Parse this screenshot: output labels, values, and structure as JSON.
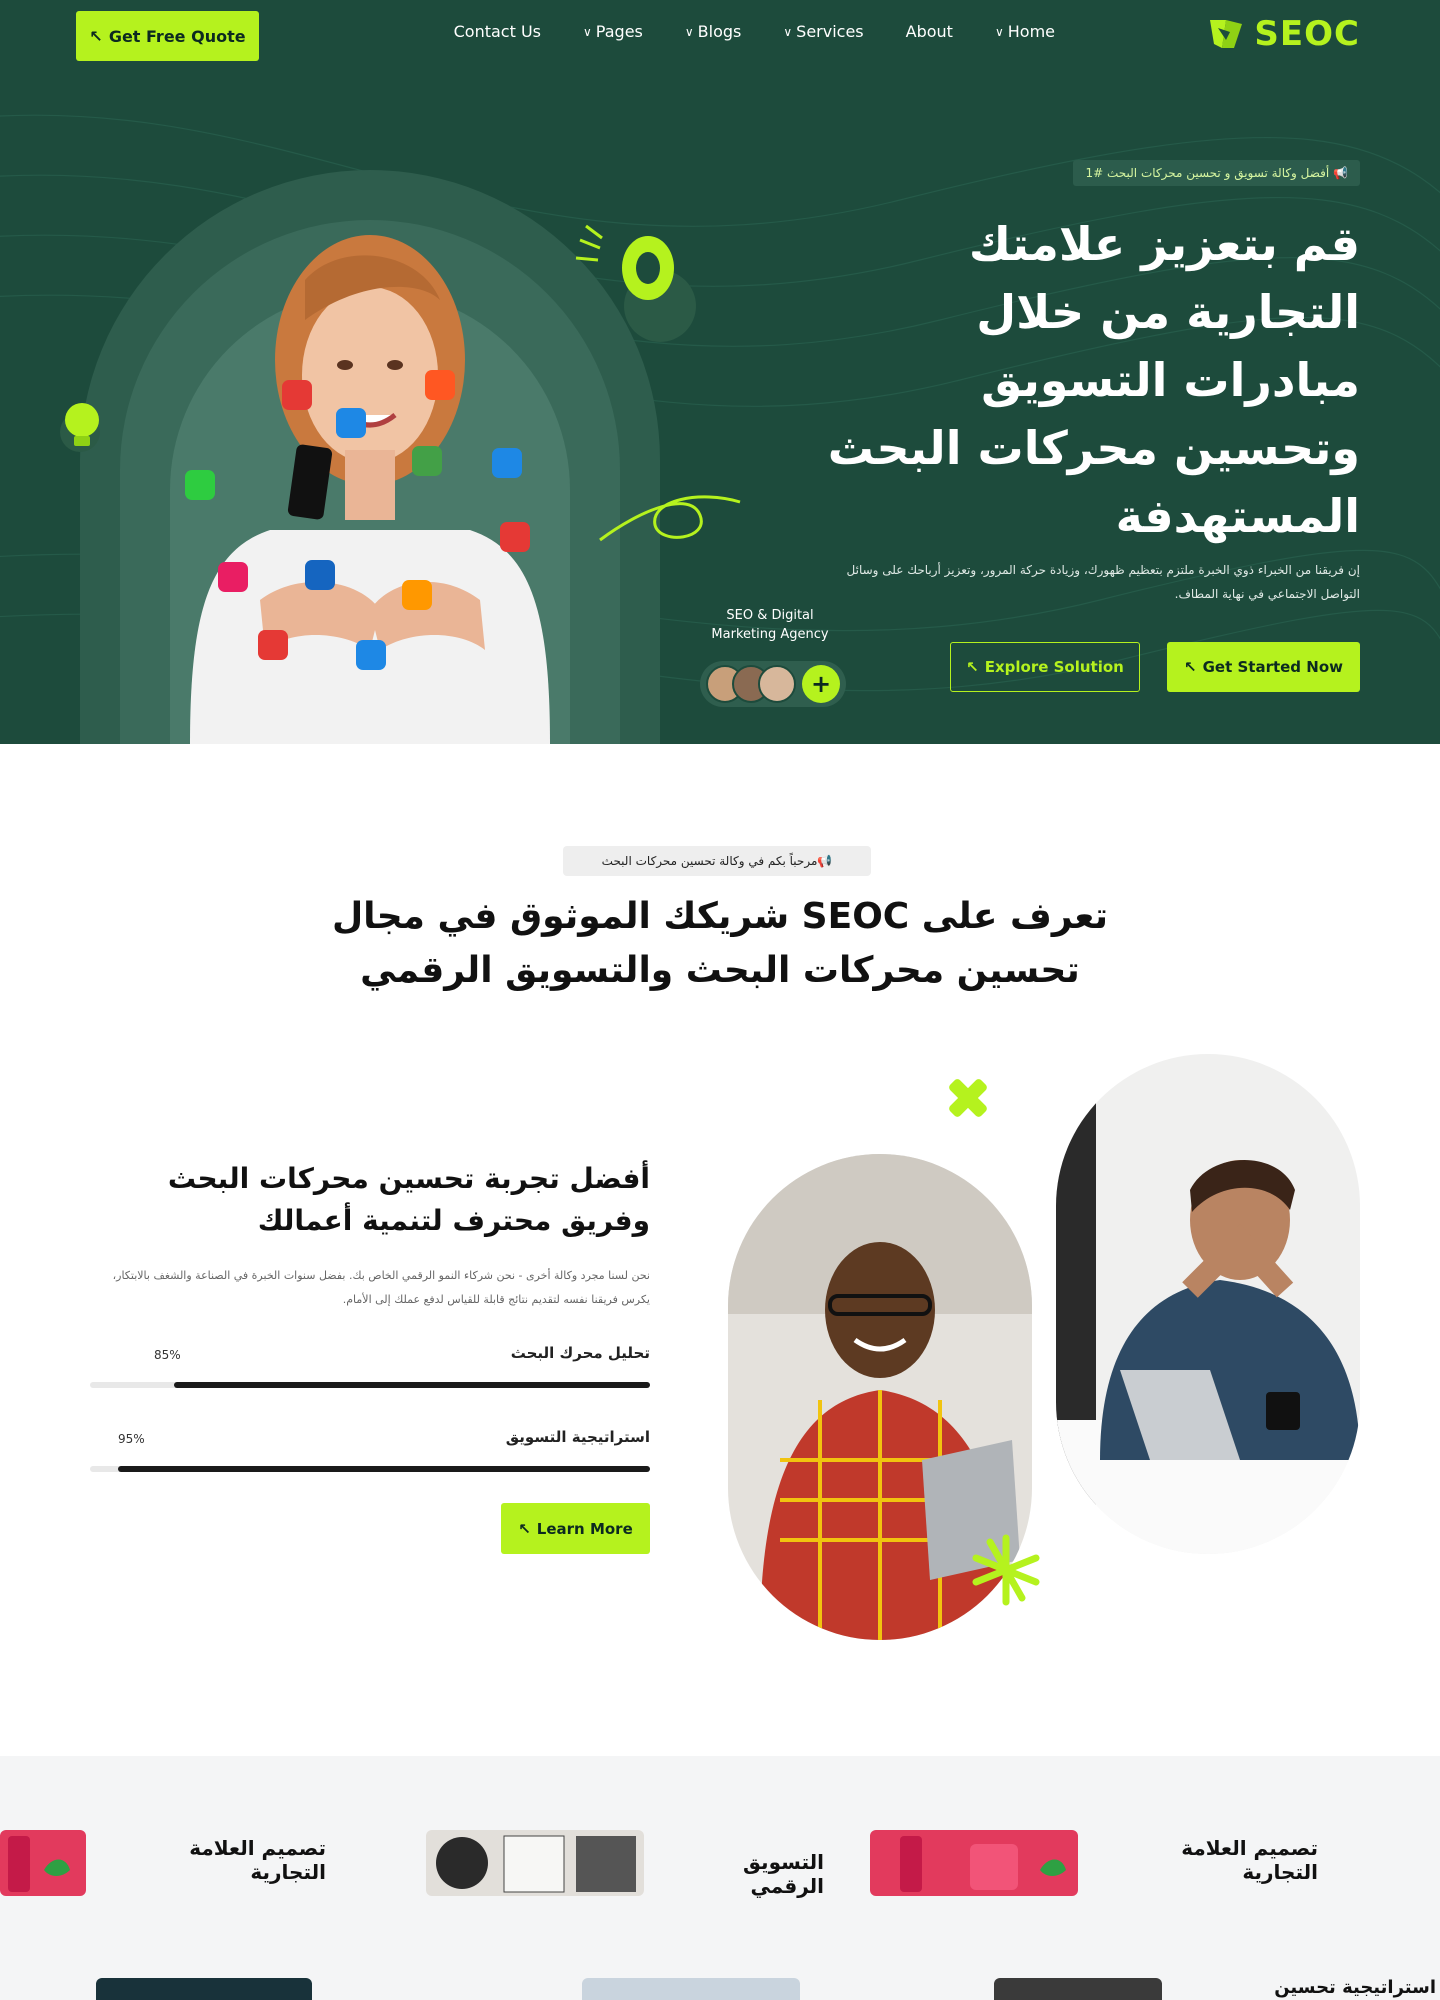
{
  "nav": {
    "quote_label": "Get Free Quote",
    "links": [
      "Contact Us",
      "Pages",
      "Blogs",
      "Services",
      "About",
      "Home"
    ],
    "logo_text": "SEOC"
  },
  "hero": {
    "badge": "أفضل وكالة تسويق و تحسين محركات البحث #1",
    "title": "قم بتعزيز علامتك التجارية من خلال مبادرات التسويق وتحسين محركات البحث المستهدفة",
    "description": "إن فريقنا من الخبراء ذوي الخبرة ملتزم بتعظيم ظهورك، وزيادة حركة المرور، وتعزيز أرباحك على وسائل التواصل الاجتماعي في نهاية المطاف.",
    "explore_label": "Explore Solution",
    "started_label": "Get Started Now",
    "agency_label": "SEO & Digital Marketing Agency",
    "plus": "+"
  },
  "about": {
    "badge": "مرحباً بكم في وكالة تحسين محركات البحث",
    "title": "تعرف على SEOC شريكك الموثوق في مجال تحسين محركات البحث والتسويق الرقمي",
    "subtitle": "أفضل تجربة تحسين محركات البحث وفريق محترف لتنمية أعمالك",
    "description": "نحن لسنا مجرد وكالة أخرى - نحن شركاء النمو الرقمي الخاص بك. بفضل سنوات الخبرة في الصناعة والشغف بالابتكار، يكرس فريقنا نفسه لتقديم نتائج قابلة للقياس لدفع عملك إلى الأمام.",
    "skills": [
      {
        "label": "تحليل محرك البحث",
        "percent_text": "85%",
        "value": 85
      },
      {
        "label": "استراتيجية التسويق",
        "percent_text": "95%",
        "value": 95
      }
    ],
    "learn_label": "Learn More"
  },
  "services": {
    "row1": [
      "تصميم العلامة التجارية",
      "التسويق الرقمي",
      "تصميم العلامة التجارية"
    ],
    "row2": [
      "استراتيجية تحسين"
    ]
  },
  "colors": {
    "brand_green": "#b5f21e",
    "hero_bg": "#1d4b3c"
  }
}
